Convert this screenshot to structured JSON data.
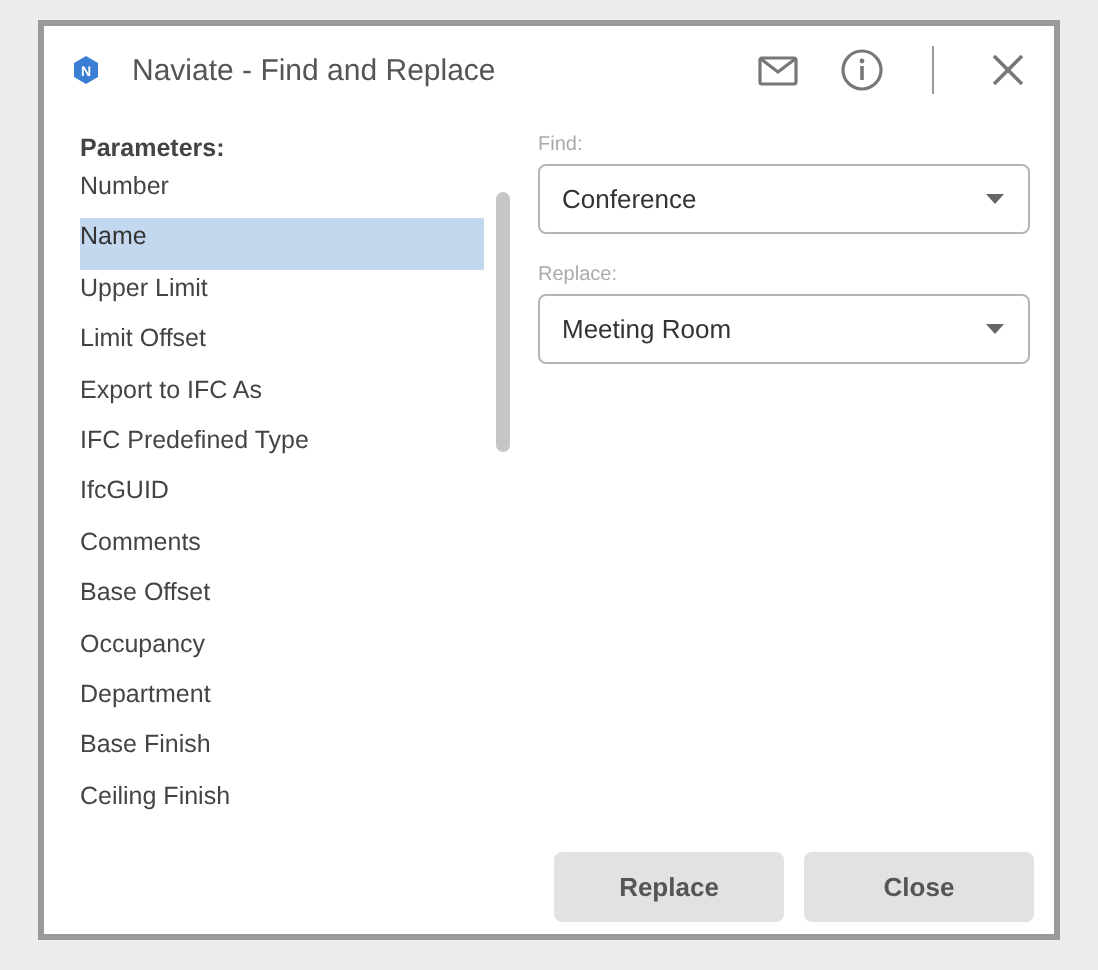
{
  "window": {
    "title": "Naviate - Find and Replace",
    "logo": "N"
  },
  "parameters": {
    "label": "Parameters:",
    "items": [
      {
        "label": "Number",
        "selected": false
      },
      {
        "label": "Name",
        "selected": true
      },
      {
        "label": "Upper Limit",
        "selected": false
      },
      {
        "label": "Limit Offset",
        "selected": false
      },
      {
        "label": "Export to IFC As",
        "selected": false
      },
      {
        "label": "IFC Predefined Type",
        "selected": false
      },
      {
        "label": "IfcGUID",
        "selected": false
      },
      {
        "label": "Comments",
        "selected": false
      },
      {
        "label": "Base Offset",
        "selected": false
      },
      {
        "label": "Occupancy",
        "selected": false
      },
      {
        "label": "Department",
        "selected": false
      },
      {
        "label": "Base Finish",
        "selected": false
      },
      {
        "label": "Ceiling Finish",
        "selected": false
      }
    ]
  },
  "fields": [
    {
      "label": "Find:",
      "value": "Conference"
    },
    {
      "label": "Replace:",
      "value": "Meeting Room"
    }
  ],
  "buttons": [
    "Replace",
    "Close"
  ]
}
